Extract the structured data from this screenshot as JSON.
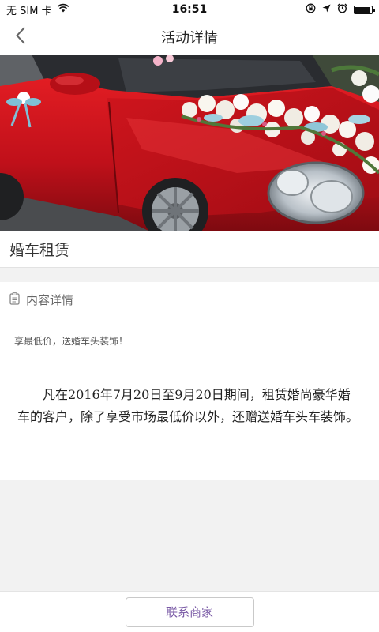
{
  "status_bar": {
    "carrier": "无 SIM 卡",
    "time": "16:51",
    "icons": [
      "wifi-icon",
      "orientation-lock-icon",
      "location-icon",
      "alarm-icon",
      "battery-icon"
    ]
  },
  "nav": {
    "title": "活动详情",
    "back_icon": "chevron-left-icon"
  },
  "hero": {
    "subject": "red convertible decorated with white and blue wedding flowers"
  },
  "activity": {
    "title": "婚车租赁"
  },
  "details": {
    "header_icon": "document-icon",
    "header_label": "内容详情",
    "summary": "享最低价，送婚车头装饰！",
    "body": "凡在2016年7月20日至9月20日期间，租赁婚尚豪华婚车的客户，除了享受市场最低价以外，还赠送婚车头车装饰。"
  },
  "bottom": {
    "contact_label": "联系商家"
  },
  "colors": {
    "accent": "#7a5aa6",
    "background": "#f2f2f2",
    "card": "#ffffff",
    "car_red": "#c8121c"
  }
}
